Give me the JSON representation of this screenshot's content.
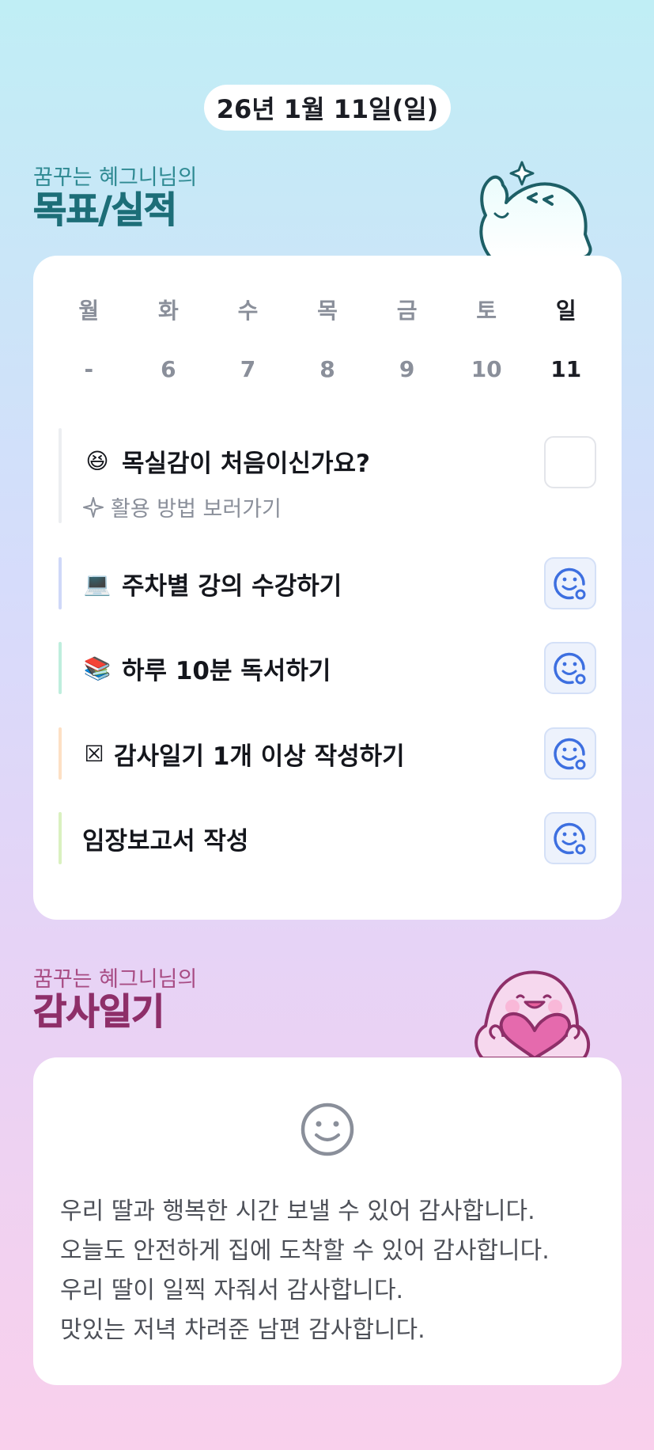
{
  "date_pill": "26년 1월 11일(일)",
  "goal_section": {
    "subtitle": "꿈꾸는 혜그니님의",
    "title": "목표/실적"
  },
  "week": {
    "days": [
      "월",
      "화",
      "수",
      "목",
      "금",
      "토",
      "일"
    ],
    "dates": [
      "-",
      "6",
      "7",
      "8",
      "9",
      "10",
      "11"
    ],
    "today_index": 6
  },
  "goals": [
    {
      "emoji": "😆",
      "label": "목실감이 처음이신가요?",
      "bar_color": "#eceef1",
      "done": false,
      "helper": "활용 방법 보러가기"
    },
    {
      "emoji": "💻",
      "label": "주차별 강의 수강하기",
      "bar_color": "#cfd8f8",
      "done": true
    },
    {
      "emoji": "📚",
      "label": "하루 10분 독서하기",
      "bar_color": "#bfeedd",
      "done": true
    },
    {
      "emoji": "☒",
      "label": "감사일기 1개 이상 작성하기",
      "bar_color": "#fde0c4",
      "done": true
    },
    {
      "emoji": "",
      "label": "임장보고서 작성",
      "bar_color": "#daf1c0",
      "done": true
    }
  ],
  "thanks_section": {
    "subtitle": "꿈꾸는 혜그니님의",
    "title": "감사일기",
    "lines": [
      "우리 딸과 행복한 시간 보낼 수 있어 감사합니다.",
      "오늘도 안전하게 집에 도착할 수 있어 감사합니다.",
      "우리 딸이 일찍 자줘서 감사합니다.",
      "맛있는 저녁 차려준 남편 감사합니다."
    ]
  },
  "colors": {
    "accent_blue": "#3d6fe0",
    "goal_title": "#1d6e78",
    "thanks_title": "#8e2f69"
  }
}
